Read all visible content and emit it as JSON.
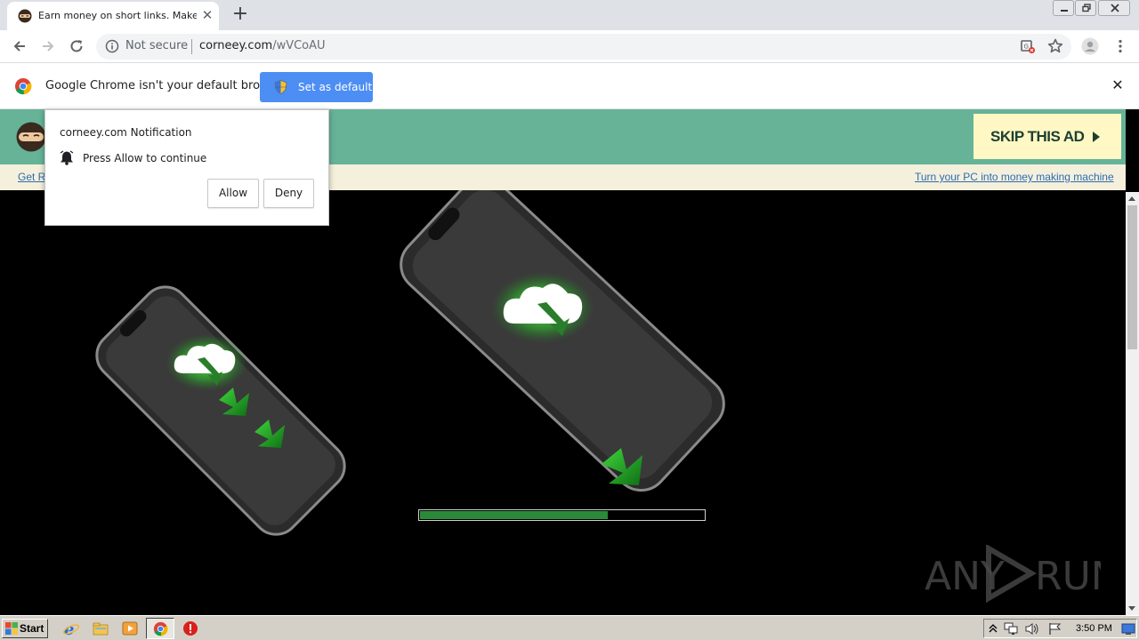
{
  "browser": {
    "tab": {
      "title": "Earn money on short links. Make short links and earn the biggest money"
    },
    "address": {
      "security_label": "Not secure",
      "host": "corneey.com",
      "path": "/wVCoAU"
    },
    "infobar": {
      "message": "Google Chrome isn't your default browser",
      "button_label": "Set as default"
    }
  },
  "notification": {
    "origin": "corneey.com Notification",
    "message": "Press Allow to continue",
    "allow_label": "Allow",
    "deny_label": "Deny"
  },
  "page": {
    "skip_label": "SKIP THIS AD",
    "left_link": "Get R",
    "right_link": "Turn your PC into money making machine",
    "progress": 0.66,
    "watermark": "ANY RUN",
    "colors": {
      "header_green": "#66b398",
      "skip_bg": "#fff8c4",
      "progress_fill": "#2a8a3a"
    }
  },
  "taskbar": {
    "start_label": "Start",
    "clock": "3:50 PM"
  }
}
